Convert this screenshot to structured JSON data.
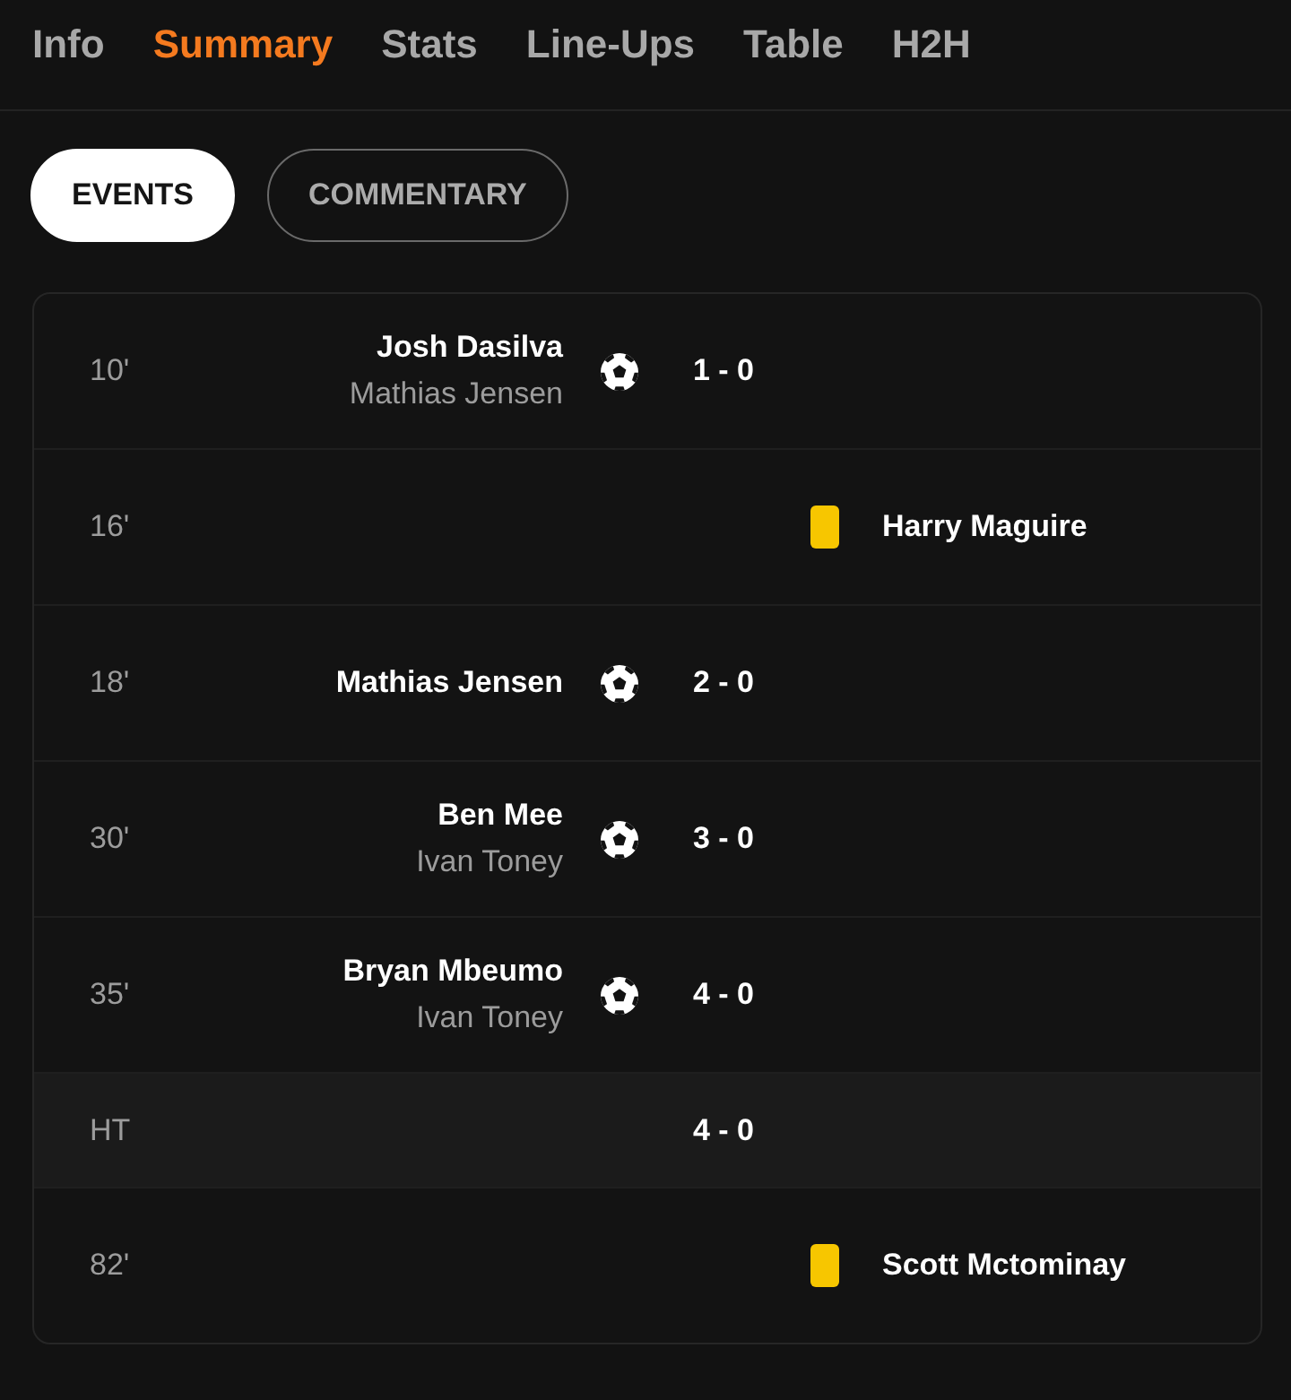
{
  "tabs": [
    {
      "label": "Info",
      "selected": false
    },
    {
      "label": "Summary",
      "selected": true
    },
    {
      "label": "Stats",
      "selected": false
    },
    {
      "label": "Line-Ups",
      "selected": false
    },
    {
      "label": "Table",
      "selected": false
    },
    {
      "label": "H2H",
      "selected": false
    }
  ],
  "filters": [
    {
      "label": "EVENTS",
      "selected": true
    },
    {
      "label": "COMMENTARY",
      "selected": false
    }
  ],
  "events": [
    {
      "kind": "goal",
      "minute": "10'",
      "home": true,
      "player": "Josh Dasilva",
      "assist": "Mathias Jensen",
      "score": "1 - 0"
    },
    {
      "kind": "yellow_card",
      "minute": "16'",
      "home": false,
      "player": "Harry Maguire"
    },
    {
      "kind": "goal",
      "minute": "18'",
      "home": true,
      "player": "Mathias Jensen",
      "score": "2 - 0"
    },
    {
      "kind": "goal",
      "minute": "30'",
      "home": true,
      "player": "Ben Mee",
      "assist": "Ivan Toney",
      "score": "3 - 0"
    },
    {
      "kind": "goal",
      "minute": "35'",
      "home": true,
      "player": "Bryan Mbeumo",
      "assist": "Ivan Toney",
      "score": "4 - 0"
    },
    {
      "kind": "period",
      "minute": "HT",
      "score": "4 - 0"
    },
    {
      "kind": "yellow_card",
      "minute": "82'",
      "home": false,
      "player": "Scott Mctominay"
    }
  ]
}
